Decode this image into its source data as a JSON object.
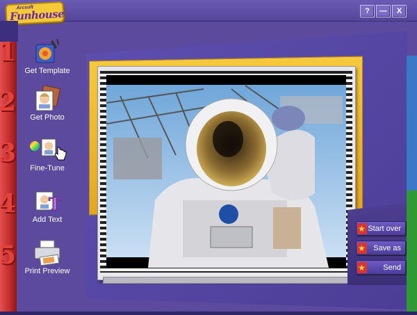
{
  "app": {
    "logo_small": "Arcsoft",
    "logo_big": "Funhouse"
  },
  "window_controls": {
    "help": "?",
    "minimize": "—",
    "close": "X"
  },
  "steps": [
    {
      "number": "1",
      "label": "Get Template"
    },
    {
      "number": "2",
      "label": "Get Photo"
    },
    {
      "number": "3",
      "label": "Fine-Tune"
    },
    {
      "number": "4",
      "label": "Add Text"
    },
    {
      "number": "5",
      "label": "Print Preview"
    }
  ],
  "actions": {
    "start_over": "Start over",
    "save_as": "Save as",
    "send": "Send"
  },
  "colors": {
    "window_bg": "#5b4a9e",
    "rail_red": "#c22b2b",
    "frame_yellow": "#f4c93a",
    "button_purple": "#5b4a9e"
  },
  "icons": [
    "template-icon",
    "photo-icon",
    "fine-tune-icon",
    "add-text-icon",
    "printer-icon",
    "hand-cursor-icon",
    "star-icon"
  ],
  "photo": {
    "subject": "astronaut in spacesuit"
  }
}
